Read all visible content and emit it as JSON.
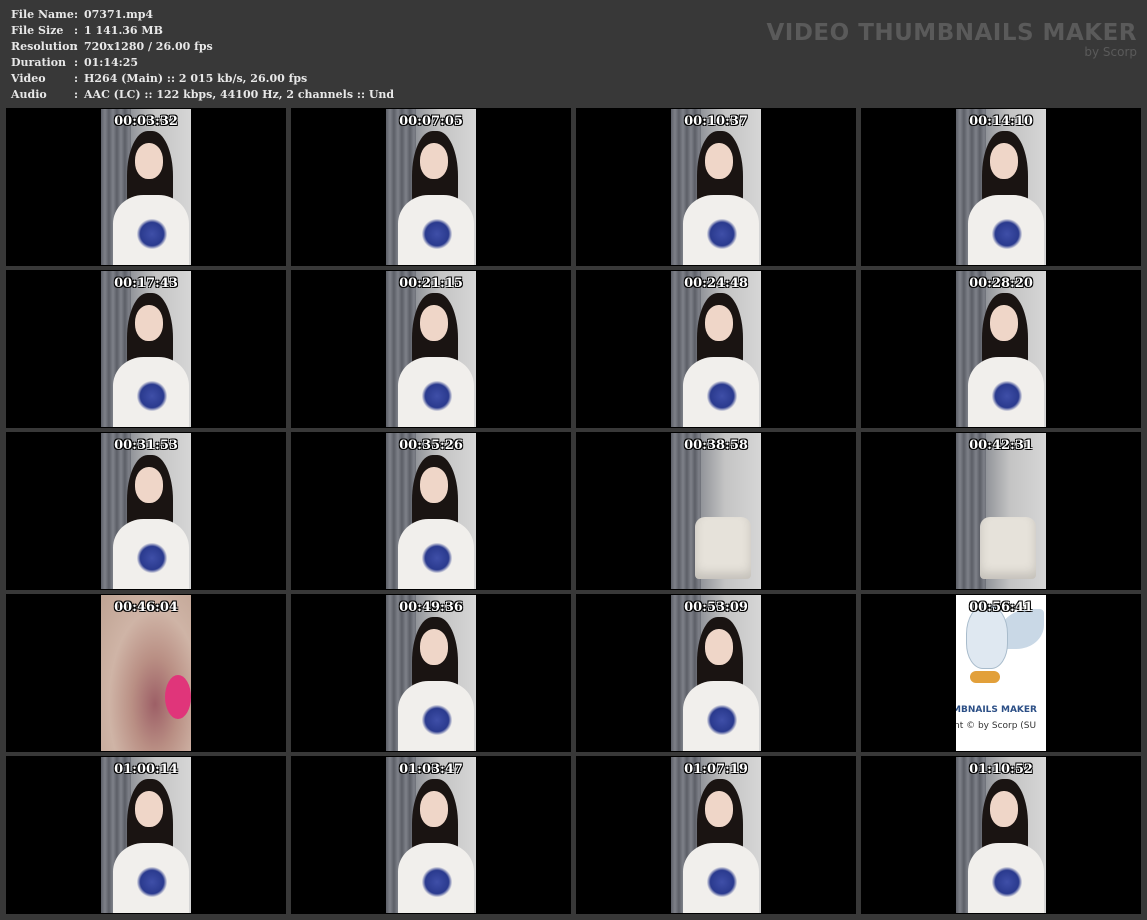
{
  "info": [
    {
      "key": "File Name",
      "sep": ":",
      "value": "07371.mp4"
    },
    {
      "key": "File Size",
      "sep": ":",
      "value": "1 141.36 MB"
    },
    {
      "key": "Resolution",
      "sep": ":",
      "value": "720x1280 / 26.00 fps"
    },
    {
      "key": "Duration",
      "sep": ":",
      "value": "01:14:25"
    },
    {
      "key": "Video",
      "sep": ":",
      "value": "H264 (Main) :: 2 015 kb/s, 26.00 fps"
    },
    {
      "key": "Audio",
      "sep": ":",
      "value": "AAC (LC) :: 122 kbps, 44100 Hz, 2 channels :: Und"
    }
  ],
  "brand": {
    "title": "VIDEO THUMBNAILS MAKER",
    "subtitle": "by Scorp"
  },
  "thumbnails": [
    {
      "time": "00:03:32",
      "scene": "person"
    },
    {
      "time": "00:07:05",
      "scene": "person"
    },
    {
      "time": "00:10:37",
      "scene": "person"
    },
    {
      "time": "00:14:10",
      "scene": "person"
    },
    {
      "time": "00:17:43",
      "scene": "person"
    },
    {
      "time": "00:21:15",
      "scene": "person"
    },
    {
      "time": "00:24:48",
      "scene": "person"
    },
    {
      "time": "00:28:20",
      "scene": "person"
    },
    {
      "time": "00:31:53",
      "scene": "person"
    },
    {
      "time": "00:35:26",
      "scene": "person"
    },
    {
      "time": "00:38:58",
      "scene": "chair"
    },
    {
      "time": "00:42:31",
      "scene": "chair"
    },
    {
      "time": "00:46:04",
      "scene": "closeup"
    },
    {
      "time": "00:49:36",
      "scene": "person"
    },
    {
      "time": "00:53:09",
      "scene": "person"
    },
    {
      "time": "00:56:41",
      "scene": "logo",
      "logo_line1": "MBNAILS MAKER",
      "logo_line2": "nt © by Scorp (SU"
    },
    {
      "time": "01:00:14",
      "scene": "person"
    },
    {
      "time": "01:03:47",
      "scene": "person"
    },
    {
      "time": "01:07:19",
      "scene": "person"
    },
    {
      "time": "01:10:52",
      "scene": "person"
    }
  ]
}
